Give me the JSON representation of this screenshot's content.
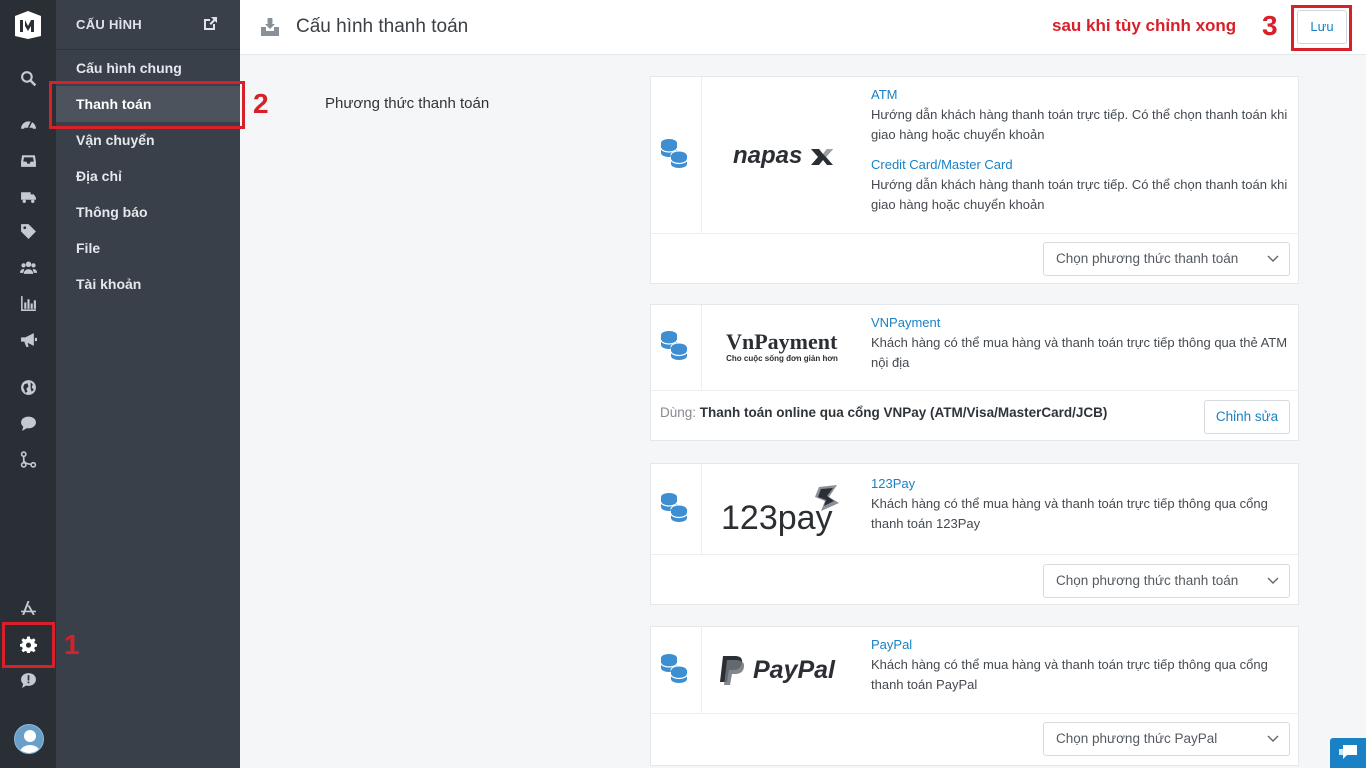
{
  "sidebar": {
    "header": "CẤU HÌNH",
    "items": [
      {
        "label": "Cấu hình chung"
      },
      {
        "label": "Thanh toán"
      },
      {
        "label": "Vận chuyển"
      },
      {
        "label": "Địa chỉ"
      },
      {
        "label": "Thông báo"
      },
      {
        "label": "File"
      },
      {
        "label": "Tài khoản"
      }
    ]
  },
  "header": {
    "title": "Cấu hình thanh toán",
    "save_label": "Lưu"
  },
  "annotations": {
    "n1": "1",
    "n2": "2",
    "n3": "3",
    "note": "sau khi tùy chỉnh xong"
  },
  "section_label": "Phương thức thanh toán",
  "cards": [
    {
      "logo": "napas",
      "methods": [
        {
          "name": "ATM",
          "text": "Hướng dẫn khách hàng thanh toán trực tiếp. Có thể chọn thanh toán khi giao hàng hoặc chuyển khoản"
        },
        {
          "name": "Credit Card/Master Card",
          "text": "Hướng dẫn khách hàng thanh toán trực tiếp. Có thể chọn thanh toán khi giao hàng hoặc chuyển khoản"
        }
      ],
      "select": "Chọn phương thức thanh toán"
    },
    {
      "logo": "VnPayment",
      "logo_sub": "Cho cuộc sống đơn giản hơn",
      "methods": [
        {
          "name": "VNPayment",
          "text": "Khách hàng có thể mua hàng và thanh toán trực tiếp thông qua thẻ ATM nội địa"
        }
      ],
      "used_prefix": "Dùng:",
      "used_value": "Thanh toán online qua cổng VNPay (ATM/Visa/MasterCard/JCB)",
      "edit_label": "Chỉnh sửa"
    },
    {
      "logo": "123pay",
      "methods": [
        {
          "name": "123Pay",
          "text": "Khách hàng có thể mua hàng và thanh toán trực tiếp thông qua cổng thanh toán 123Pay"
        }
      ],
      "select": "Chọn phương thức thanh toán"
    },
    {
      "logo": "PayPal",
      "methods": [
        {
          "name": "PayPal",
          "text": "Khách hàng có thể mua hàng và thanh toán trực tiếp thông qua cổng thanh toán PayPal"
        }
      ],
      "select": "Chọn phương thức PayPal"
    }
  ],
  "colors": {
    "rail": "#2a2f36",
    "sidebar": "#3a4049",
    "accent": "#1a82c4",
    "annotation": "#d7202a"
  },
  "icons": [
    "logo-icon",
    "search-icon",
    "dashboard-icon",
    "inbox-icon",
    "truck-icon",
    "tag-icon",
    "users-icon",
    "chart-icon",
    "megaphone-icon",
    "globe-icon",
    "chat-icon",
    "flow-icon",
    "app-store-icon",
    "gear-icon",
    "alert-icon",
    "avatar-icon",
    "external-link-icon",
    "database-icon",
    "chevron-down-icon"
  ]
}
